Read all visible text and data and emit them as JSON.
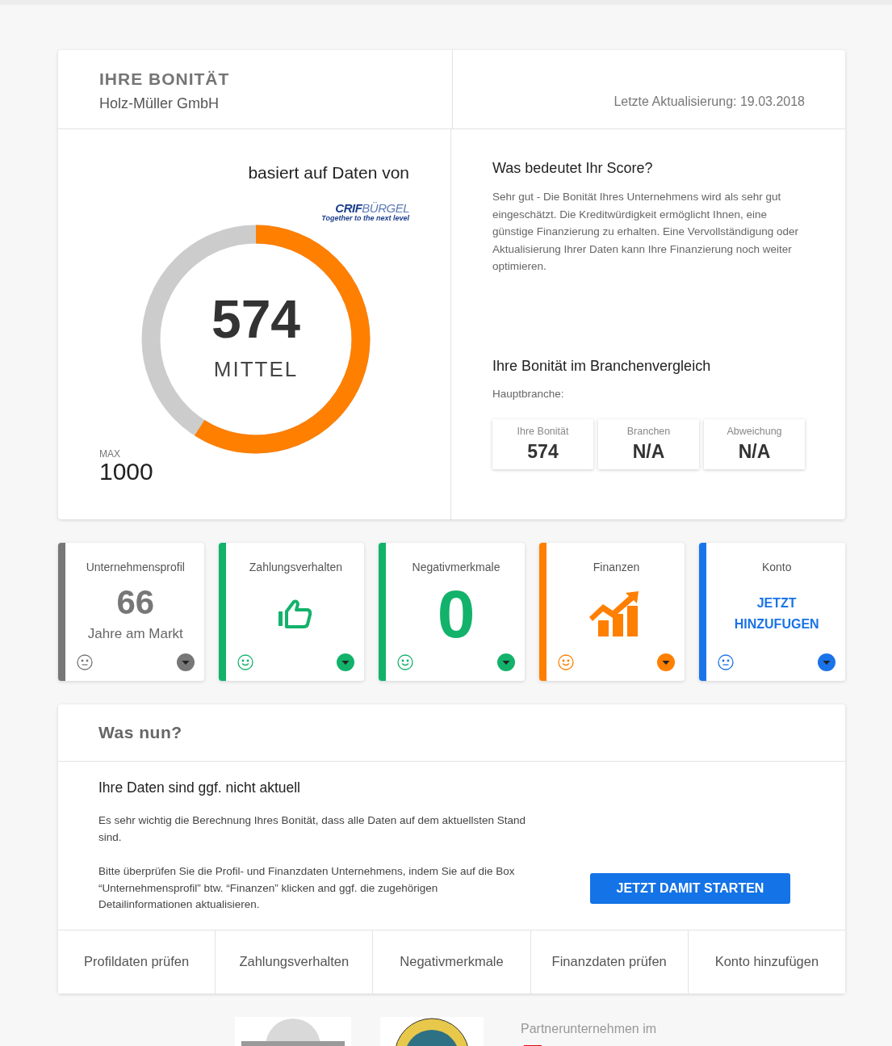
{
  "header": {
    "title": "IHRE BONITÄT",
    "company": "Holz-Müller GmbH",
    "updated": "Letzte Aktualisierung: 19.03.2018"
  },
  "score": {
    "source_label": "basiert auf Daten von",
    "logo": {
      "part_1": "CRIF",
      "part_2": "BÜRGEL",
      "tagline": "Together to the next level"
    },
    "value": "574",
    "rating": "MITTEL",
    "level": 0.59,
    "max_label": "MAX",
    "max_value": "1000"
  },
  "explanation": {
    "title": "Was bedeutet Ihr Score?",
    "text": "Sehr gut - Die Bonität Ihres Unternehmens wird als sehr gut eingeschätzt. Die Kreditwürdigkeit ermöglicht Ihnen, eine günstige Finanzierung zu erhalten. Eine Vervollständigung oder Aktualisierung Ihrer Daten kann Ihre Finanzierung noch weiter optimieren."
  },
  "comparison": {
    "title": "Ihre Bonität im Branchenvergleich",
    "subtitle": "Hauptbranche:",
    "boxes": [
      {
        "label": "Ihre Bonität",
        "value": "574"
      },
      {
        "label": "Branchen",
        "value": "N/A"
      },
      {
        "label": "Abweichung",
        "value": "N/A"
      }
    ]
  },
  "tiles": [
    {
      "title": "Unternehmensprofil",
      "kind": "number",
      "value": "66",
      "caption": "Jahre am Markt",
      "color": "#777777",
      "happy": false
    },
    {
      "title": "Zahlungsverhalten",
      "kind": "thumb",
      "color": "#13b26b",
      "happy": true
    },
    {
      "title": "Negativmerkmale",
      "kind": "big-number",
      "value": "0",
      "color": "#13b26b",
      "happy": true
    },
    {
      "title": "Finanzen",
      "kind": "chart",
      "color": "#ff7f00",
      "happy": true
    },
    {
      "title": "Konto",
      "kind": "link",
      "link_lines": [
        "JETZT",
        "HINZUFUGEN"
      ],
      "color": "#1a73e8",
      "happy": false
    }
  ],
  "next": {
    "title": "Was nun?",
    "heading": "Ihre Daten sind ggf. nicht aktuell",
    "paragraph_1": "Es sehr wichtig die Berechnung Ihres Bonität, dass alle Daten auf dem aktuellsten Stand sind.",
    "paragraph_2": "Bitte überprüfen Sie die Profil- und Finanzdaten Unternehmens, indem Sie auf die Box “Unternehmensprofil” btw. “Finanzen” klicken and ggf. die zugehörigen Detailinformationen aktualisieren.",
    "button": "JETZT DAMIT STARTEN",
    "actions": [
      "Profildaten prüfen",
      "Zahlungsverhalten",
      "Negativmerkmale",
      "Finanzdaten prüfen",
      "Konto hinzufügen"
    ]
  },
  "footer": {
    "partner_text": "Partnerunternehmen im"
  }
}
